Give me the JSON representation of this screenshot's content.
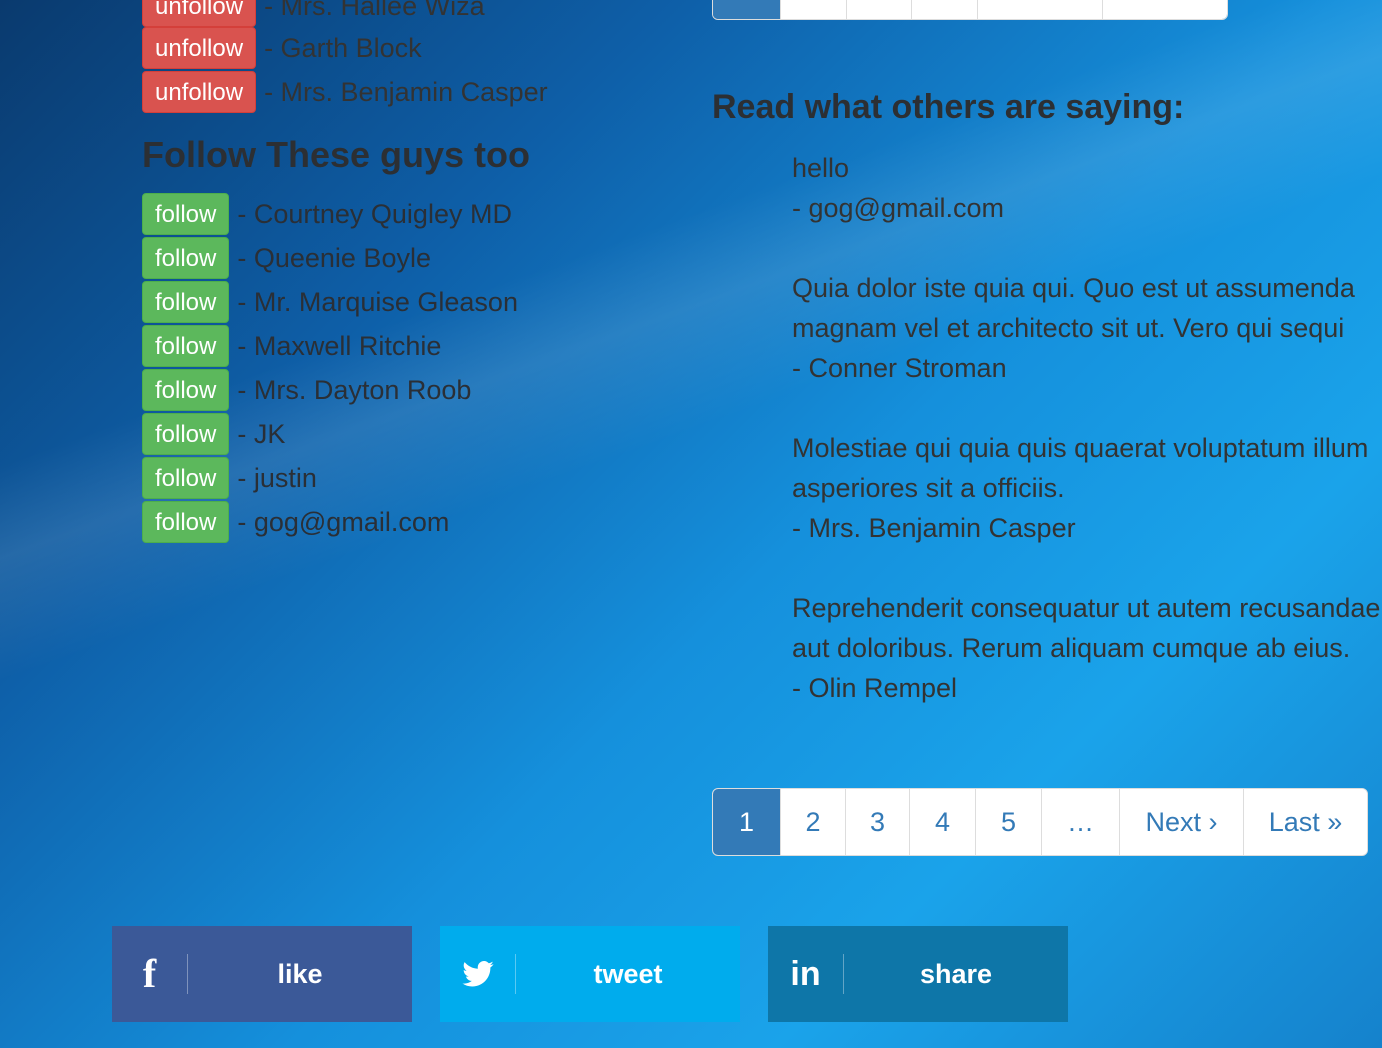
{
  "following": {
    "items": [
      {
        "button": "unfollow",
        "name": "- Mrs. Hallee Wiza"
      },
      {
        "button": "unfollow",
        "name": "- Garth Block"
      },
      {
        "button": "unfollow",
        "name": "- Mrs. Benjamin Casper"
      }
    ]
  },
  "suggestions": {
    "heading": "Follow These guys too",
    "items": [
      {
        "button": "follow",
        "name": "- Courtney Quigley MD"
      },
      {
        "button": "follow",
        "name": "- Queenie Boyle"
      },
      {
        "button": "follow",
        "name": "- Mr. Marquise Gleason"
      },
      {
        "button": "follow",
        "name": "- Maxwell Ritchie"
      },
      {
        "button": "follow",
        "name": "- Mrs. Dayton Roob"
      },
      {
        "button": "follow",
        "name": "- JK"
      },
      {
        "button": "follow",
        "name": "- justin"
      },
      {
        "button": "follow",
        "name": "- gog@gmail.com"
      }
    ]
  },
  "reviews": {
    "heading": "Read what others are saying:",
    "items": [
      {
        "lines": [
          "hello"
        ],
        "author": "- gog@gmail.com"
      },
      {
        "lines": [
          "Quia dolor iste quia qui. Quo est ut assumenda",
          "magnam vel et architecto sit ut. Vero qui sequi"
        ],
        "author": "- Conner Stroman"
      },
      {
        "lines": [
          "Molestiae qui quia quis quaerat voluptatum illum",
          "asperiores sit a officiis."
        ],
        "author": "- Mrs. Benjamin Casper"
      },
      {
        "lines": [
          "Reprehenderit consequatur ut autem recusandae",
          "aut doloribus. Rerum aliquam cumque ab eius."
        ],
        "author": "- Olin Rempel"
      }
    ]
  },
  "pagination": {
    "pages": [
      "1",
      "2",
      "3",
      "4",
      "5",
      "…",
      "Next ›",
      "Last »"
    ],
    "active": "1"
  },
  "social": {
    "facebook": {
      "icon": "facebook-icon",
      "glyph": "f",
      "label": "like",
      "color": "#3b5998"
    },
    "twitter": {
      "icon": "twitter-icon",
      "label": "tweet",
      "color": "#00aced"
    },
    "linkedin": {
      "icon": "linkedin-icon",
      "glyph": "in",
      "label": "share",
      "color": "#0e76a8"
    }
  }
}
